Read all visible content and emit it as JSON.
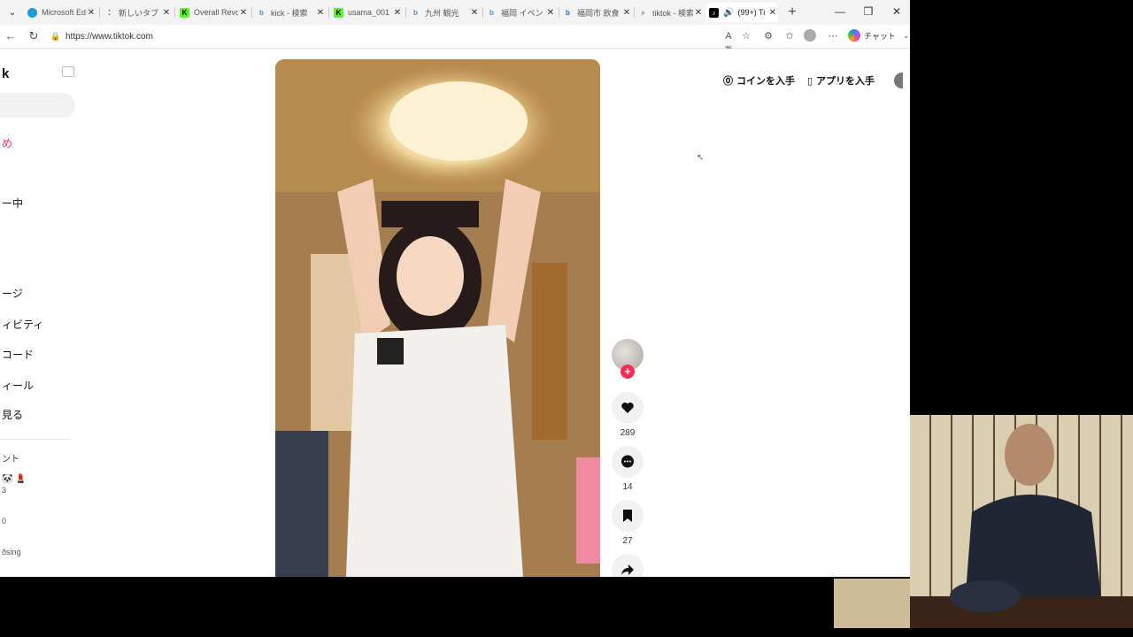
{
  "browser": {
    "tabs": [
      {
        "label": "Microsoft Ed",
        "favicon": "edge-icon",
        "color": "#1c9bd6"
      },
      {
        "label": "新しいタブ",
        "favicon": "loading-icon",
        "color": "#888888"
      },
      {
        "label": "Overall Revo",
        "favicon": "k-icon",
        "color": "#53fc18"
      },
      {
        "label": "kick - 検索",
        "favicon": "bing-icon",
        "color": "#4a90d9"
      },
      {
        "label": "usama_001",
        "favicon": "k-icon",
        "color": "#53fc18"
      },
      {
        "label": "九州 観光",
        "favicon": "bing-icon",
        "color": "#4a90d9"
      },
      {
        "label": "福岡 イベント",
        "favicon": "bing-icon",
        "color": "#4a90d9"
      },
      {
        "label": "福岡市 飲食",
        "favicon": "bing-icon",
        "color": "#1c6fd6"
      },
      {
        "label": "tiktok - 検索",
        "favicon": "search-icon",
        "color": "#888888"
      },
      {
        "label": "(99+) Ti",
        "favicon": "tiktok-icon",
        "color": "#000000",
        "active": true
      }
    ],
    "url": "https://www.tiktok.com",
    "chat_label": "チャット"
  },
  "sidebar": {
    "logo": "k",
    "nav": [
      {
        "label": "め",
        "highlight": true
      },
      {
        "label": "ー中"
      },
      {
        "label": "ージ"
      },
      {
        "label": "ィビティ"
      },
      {
        "label": "コード"
      },
      {
        "label": "ィール"
      },
      {
        "label": "見る"
      }
    ],
    "section_label": "ント",
    "following_emojis": "🐼 💄",
    "footer_lines": [
      "3",
      "0",
      "ðsing"
    ]
  },
  "header_actions": {
    "coins": "コインを入手",
    "app": "アプリを入手"
  },
  "video": {
    "likes": "289",
    "comments": "14",
    "saves": "27"
  },
  "colors": {
    "accent": "#fe2c55",
    "action_bg": "#f1f1f2"
  }
}
